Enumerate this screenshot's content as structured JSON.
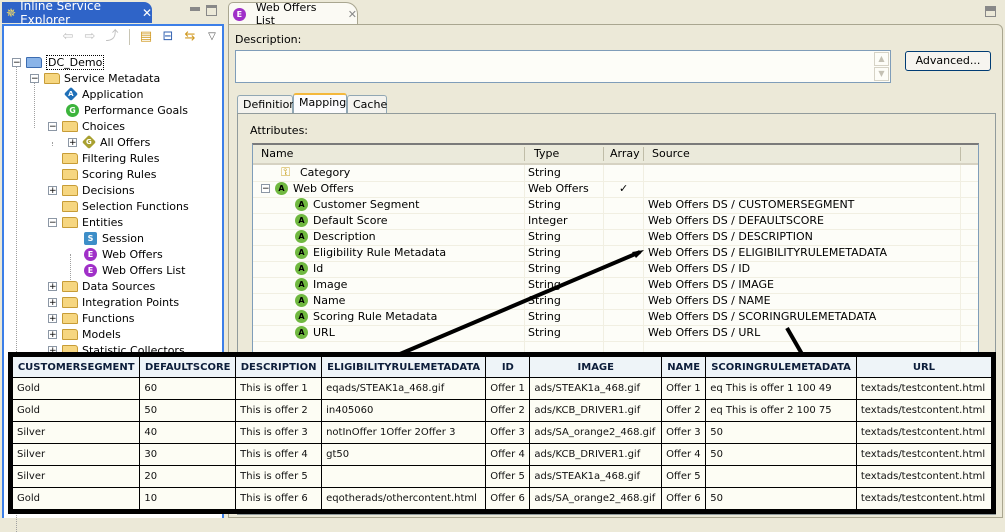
{
  "explorer": {
    "title": "Inline Service Explorer",
    "close_glyph": "✕",
    "toolbar": {
      "back": "⇦",
      "forward": "⇨",
      "up": "⤴",
      "collapse_all": "⊟",
      "link": "⇆",
      "menu": "▽"
    },
    "tree": [
      {
        "label": "DC_Demo",
        "level": 0,
        "toggle": "−",
        "icon": "project-icon",
        "selected": true
      },
      {
        "label": "Service Metadata",
        "level": 1,
        "toggle": "−",
        "icon": "metadata-folder-icon"
      },
      {
        "label": "Application",
        "level": 2,
        "icon": "application-icon",
        "badge": "A"
      },
      {
        "label": "Performance Goals",
        "level": 2,
        "icon": "goals-icon",
        "badge": "G"
      },
      {
        "label": "Choices",
        "level": 1,
        "toggle": "−",
        "icon": "folder-icon"
      },
      {
        "label": "All Offers",
        "level": 2,
        "toggle": "+",
        "icon": "choice-group-icon",
        "badge": "G"
      },
      {
        "label": "Filtering Rules",
        "level": 1,
        "icon": "folder-icon"
      },
      {
        "label": "Scoring Rules",
        "level": 1,
        "icon": "folder-icon"
      },
      {
        "label": "Decisions",
        "level": 1,
        "toggle": "+",
        "icon": "folder-icon"
      },
      {
        "label": "Selection Functions",
        "level": 1,
        "icon": "folder-icon"
      },
      {
        "label": "Entities",
        "level": 1,
        "toggle": "−",
        "icon": "folder-icon"
      },
      {
        "label": "Session",
        "level": 2,
        "icon": "session-icon",
        "badge": "S"
      },
      {
        "label": "Web Offers",
        "level": 2,
        "icon": "entity-icon",
        "badge": "E"
      },
      {
        "label": "Web Offers List",
        "level": 2,
        "icon": "entity-icon",
        "badge": "E"
      },
      {
        "label": "Data Sources",
        "level": 1,
        "toggle": "+",
        "icon": "folder-icon"
      },
      {
        "label": "Integration Points",
        "level": 1,
        "toggle": "+",
        "icon": "folder-icon"
      },
      {
        "label": "Functions",
        "level": 1,
        "toggle": "+",
        "icon": "folder-icon"
      },
      {
        "label": "Models",
        "level": 1,
        "toggle": "+",
        "icon": "folder-icon"
      },
      {
        "label": "Statistic Collectors",
        "level": 1,
        "toggle": "+",
        "icon": "folder-icon"
      }
    ]
  },
  "editor": {
    "tab_title": "Web Offers List",
    "tab_badge": "E",
    "close_glyph": "✕",
    "description_label": "Description:",
    "description_value": "",
    "advanced_button": "Advanced...",
    "tabs": [
      "Definition",
      "Mapping",
      "Cache"
    ],
    "active_tab": "Mapping",
    "attributes_label": "Attributes:",
    "columns": [
      "Name",
      "Type",
      "Array",
      "Source"
    ],
    "rows": [
      {
        "name": "Category",
        "type": "String",
        "array": "",
        "source": "",
        "icon": "key"
      },
      {
        "name": "Web Offers",
        "type": "Web Offers",
        "array": "✓",
        "source": "",
        "icon": "A",
        "toggle": "−"
      },
      {
        "name": "Customer Segment",
        "type": "String",
        "array": "",
        "source": "Web Offers DS / CUSTOMERSEGMENT",
        "icon": "A"
      },
      {
        "name": "Default Score",
        "type": "Integer",
        "array": "",
        "source": "Web Offers DS / DEFAULTSCORE",
        "icon": "A"
      },
      {
        "name": "Description",
        "type": "String",
        "array": "",
        "source": "Web Offers DS / DESCRIPTION",
        "icon": "A"
      },
      {
        "name": "Eligibility Rule Metadata",
        "type": "String",
        "array": "",
        "source": "Web Offers DS / ELIGIBILITYRULEMETADATA",
        "icon": "A"
      },
      {
        "name": "Id",
        "type": "String",
        "array": "",
        "source": "Web Offers DS / ID",
        "icon": "A"
      },
      {
        "name": "Image",
        "type": "String",
        "array": "",
        "source": "Web Offers DS / IMAGE",
        "icon": "A"
      },
      {
        "name": "Name",
        "type": "String",
        "array": "",
        "source": "Web Offers DS / NAME",
        "icon": "A"
      },
      {
        "name": "Scoring Rule Metadata",
        "type": "String",
        "array": "",
        "source": "Web Offers DS / SCORINGRULEMETADATA",
        "icon": "A"
      },
      {
        "name": "URL",
        "type": "String",
        "array": "",
        "source": "Web Offers DS / URL",
        "icon": "A"
      }
    ]
  },
  "data_table": {
    "columns": [
      "CUSTOMERSEGMENT",
      "DEFAULTSCORE",
      "DESCRIPTION",
      "ELIGIBILITYRULEMETADATA",
      "ID",
      "IMAGE",
      "NAME",
      "SCORINGRULEMETADATA",
      "URL"
    ],
    "rows": [
      [
        "Gold",
        "60",
        "This is offer 1",
        "eqads/STEAK1a_468.gif",
        "Offer 1",
        "ads/STEAK1a_468.gif",
        "Offer 1",
        "eq This is offer 1 100 49",
        "textads/testcontent.html"
      ],
      [
        "Gold",
        "50",
        "This is offer 2",
        "in405060",
        "Offer 2",
        "ads/KCB_DRIVER1.gif",
        "Offer 2",
        "eq This is offer 2 100 75",
        "textads/testcontent.html"
      ],
      [
        "Silver",
        "40",
        "This is offer 3",
        "notInOffer 1Offer 2Offer 3",
        "Offer 3",
        "ads/SA_orange2_468.gif",
        "Offer 3",
        "50",
        "textads/testcontent.html"
      ],
      [
        "Silver",
        "30",
        "This is offer 4",
        "gt50",
        "Offer 4",
        "ads/KCB_DRIVER1.gif",
        "Offer 4",
        "50",
        "textads/testcontent.html"
      ],
      [
        "Silver",
        "20",
        "This is offer 5",
        "",
        "Offer 5",
        "ads/STEAK1a_468.gif",
        "Offer 5",
        "",
        "textads/testcontent.html"
      ],
      [
        "Gold",
        "10",
        "This is offer 6",
        "eqotherads/othercontent.html",
        "Offer 6",
        "ads/SA_orange2_468.gif",
        "Offer 6",
        "50",
        "textads/testcontent.html"
      ]
    ]
  },
  "colors": {
    "active_view_blue": "#2f64c8",
    "active_tab_accent": "#f4b83c",
    "entity_purple": "#a030c8",
    "attribute_green": "#70b840"
  }
}
